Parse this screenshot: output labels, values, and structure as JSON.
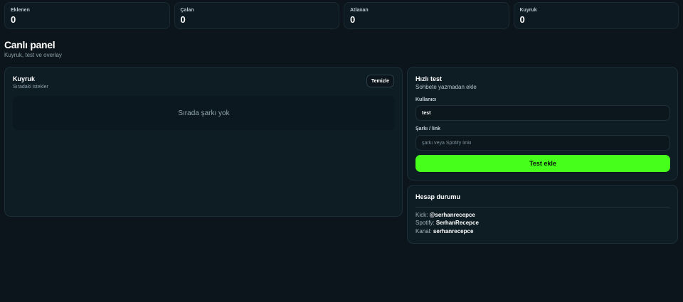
{
  "stats": [
    {
      "label": "Eklenen",
      "value": "0"
    },
    {
      "label": "Çalan",
      "value": "0"
    },
    {
      "label": "Atlanan",
      "value": "0"
    },
    {
      "label": "Kuyruk",
      "value": "0"
    }
  ],
  "page": {
    "title": "Canlı panel",
    "subtitle": "Kuyruk, test ve overlay"
  },
  "queue": {
    "title": "Kuyruk",
    "subtitle": "Sıradaki istekler",
    "clear_label": "Temizle",
    "empty_text": "Sırada şarkı yok"
  },
  "quick_test": {
    "title": "Hızlı test",
    "subtitle": "Sohbete yazmadan ekle",
    "user_label": "Kullanıcı",
    "user_value": "test",
    "song_label": "Şarkı / link",
    "song_value": "",
    "song_placeholder": "şarkı veya Spotify linki",
    "submit_label": "Test ekle"
  },
  "account": {
    "title": "Hesap durumu",
    "kick_label": "Kick:",
    "kick_value": "@serhanrecepce",
    "spotify_label": "Spotify:",
    "spotify_value": "SerhanRecepce",
    "channel_label": "Kanal:",
    "channel_value": "serhanrecepce"
  },
  "colors": {
    "background": "#0b151b",
    "card": "#0e1c24",
    "accent": "#46ff1a"
  }
}
